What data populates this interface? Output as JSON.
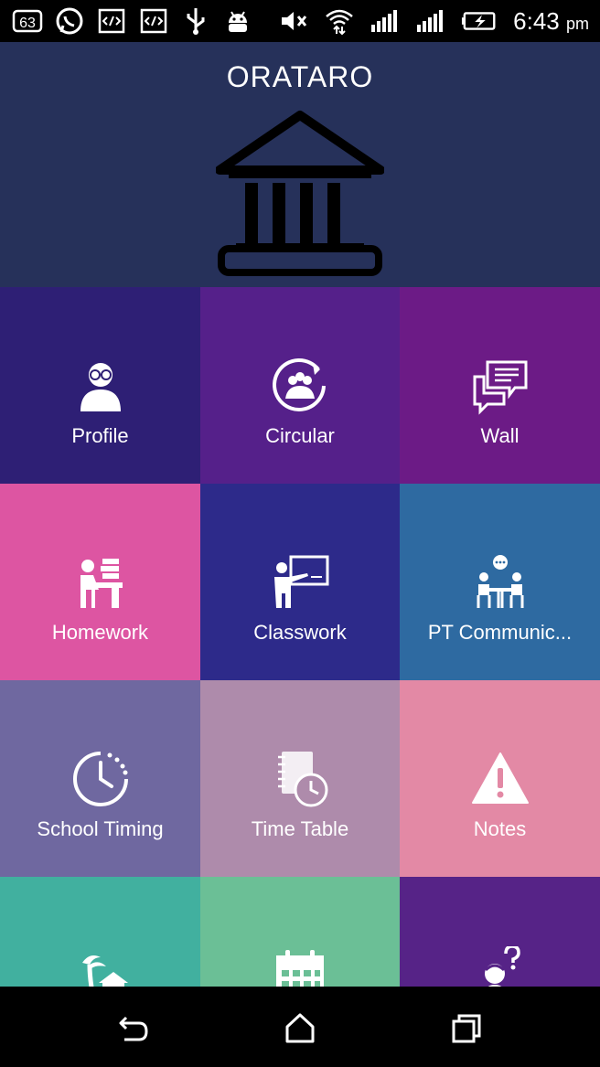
{
  "status_bar": {
    "time": "6:43",
    "ampm": "pm",
    "left_icons": [
      "notification-count-icon",
      "whatsapp-icon",
      "code-icon",
      "code-icon",
      "usb-icon",
      "android-icon"
    ],
    "right_icons": [
      "mute-icon",
      "wifi-icon",
      "signal-icon",
      "signal-2-icon",
      "battery-charging-icon"
    ],
    "notification_count": "63"
  },
  "header": {
    "title": "ORATARO",
    "logo_icon": "institution-icon"
  },
  "menu": [
    {
      "label": "Profile",
      "icon": "profile-icon",
      "color": "#2e1f75"
    },
    {
      "label": "Circular",
      "icon": "circular-icon",
      "color": "#55208a"
    },
    {
      "label": "Wall",
      "icon": "chat-icon",
      "color": "#6c1b86"
    },
    {
      "label": "Homework",
      "icon": "homework-icon",
      "color": "#dd55a2"
    },
    {
      "label": "Classwork",
      "icon": "classwork-icon",
      "color": "#2d2a8a"
    },
    {
      "label": "PT Communic...",
      "icon": "pt-communication-icon",
      "color": "#2e6aa1"
    },
    {
      "label": "School Timing",
      "icon": "clock-icon",
      "color": "#6f68a0"
    },
    {
      "label": "Time Table",
      "icon": "timetable-icon",
      "color": "#ae8bab"
    },
    {
      "label": "Notes",
      "icon": "warning-icon",
      "color": "#e389a5"
    },
    {
      "label": "",
      "icon": "holiday-icon",
      "color": "#41b09f"
    },
    {
      "label": "",
      "icon": "calendar-icon",
      "color": "#6bbf96"
    },
    {
      "label": "",
      "icon": "question-icon",
      "color": "#562387"
    }
  ],
  "nav_bar": {
    "back": "back-icon",
    "home": "home-icon",
    "recents": "recents-icon"
  }
}
